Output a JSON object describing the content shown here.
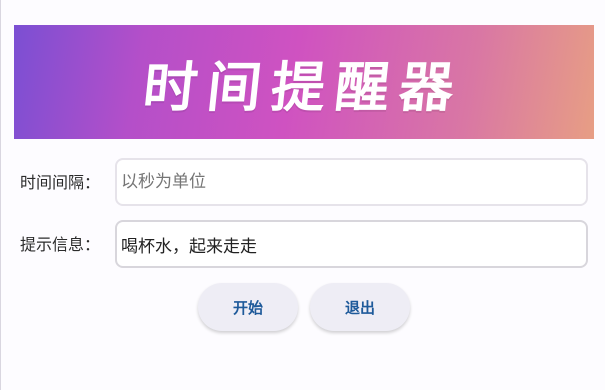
{
  "banner": {
    "title": "时间提醒器"
  },
  "form": {
    "interval": {
      "label": "时间间隔：",
      "value": "",
      "placeholder": "以秒为单位"
    },
    "message": {
      "label": "提示信息：",
      "value": "喝杯水，起来走走",
      "placeholder": ""
    }
  },
  "actions": {
    "start_label": "开始",
    "exit_label": "退出"
  },
  "colors": {
    "banner_gradient": [
      "#7b4fd3",
      "#cf52c1",
      "#e79e84"
    ],
    "button_text": "#1e5a9a",
    "button_bg": "#eeedf5"
  }
}
